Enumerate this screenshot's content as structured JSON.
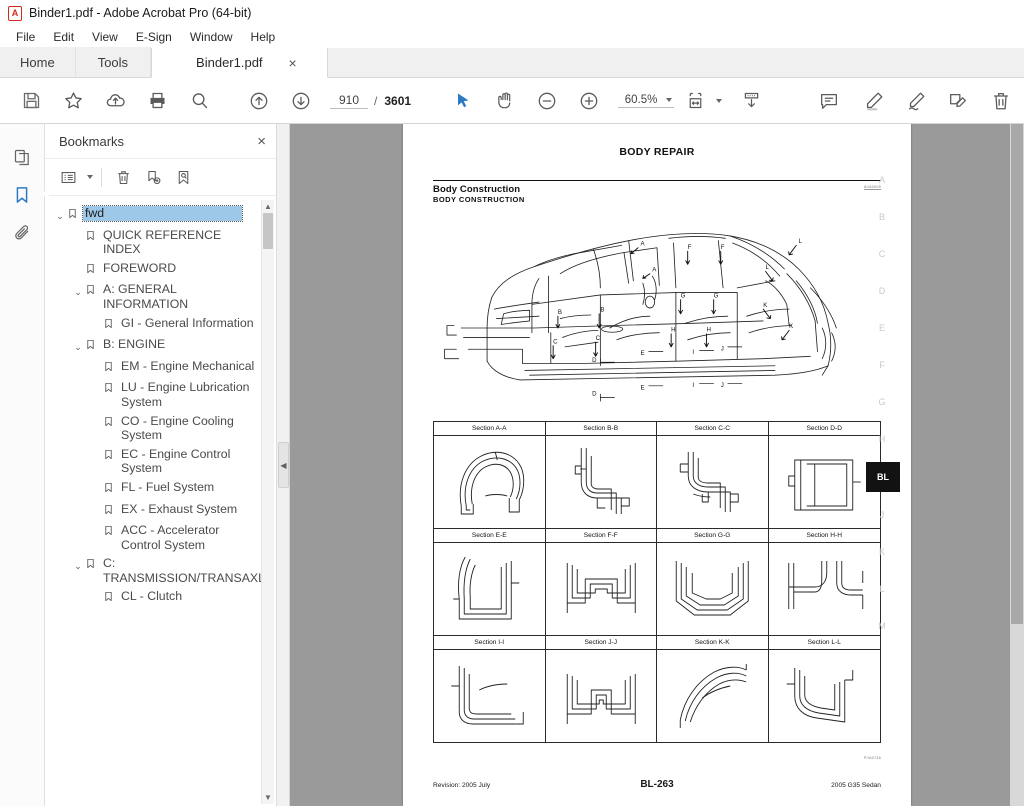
{
  "window": {
    "title": "Binder1.pdf - Adobe Acrobat Pro (64-bit)",
    "app_icon": "acrobat-logo-icon"
  },
  "menubar": {
    "items": [
      "File",
      "Edit",
      "View",
      "E-Sign",
      "Window",
      "Help"
    ]
  },
  "tabs": {
    "home": "Home",
    "tools": "Tools",
    "document": "Binder1.pdf",
    "close_glyph": "×"
  },
  "toolbar": {
    "icons": [
      "save-icon",
      "star-icon",
      "upload-cloud-icon",
      "print-icon",
      "search-icon",
      "previous-page-icon",
      "next-page-icon"
    ],
    "page_current": "910",
    "page_separator": "/",
    "page_total": "3601",
    "select_tool": "select-cursor-icon",
    "hand_tool": "hand-icon",
    "zoom_out": "zoom-out-icon",
    "zoom_in": "zoom-in-icon",
    "zoom_level": "60.5%",
    "fit_page": "fit-page-icon",
    "scroll_mode": "page-scroll-icon",
    "comment": "comment-icon",
    "highlight": "highlight-pen-icon",
    "draw": "freehand-draw-icon",
    "sign": "sign-icon",
    "delete": "trash-icon"
  },
  "rail": {
    "items": [
      {
        "name": "page-thumbnails-icon",
        "label": "Page Thumbnails",
        "active": false
      },
      {
        "name": "bookmarks-icon",
        "label": "Bookmarks",
        "active": true
      },
      {
        "name": "attachments-icon",
        "label": "Attachments",
        "active": false
      }
    ]
  },
  "bookmarks_panel": {
    "title": "Bookmarks",
    "close_glyph": "×",
    "tools": [
      "bookmark-options-icon",
      "delete-bookmark-icon",
      "new-bookmark-icon",
      "find-bookmark-icon"
    ],
    "scroll_up_glyph": "▲",
    "scroll_down_glyph": "▼",
    "items": [
      {
        "label": "fwd",
        "indent": 0,
        "twisty": "⌄",
        "selected": true
      },
      {
        "label": "QUICK REFERENCE INDEX",
        "indent": 1,
        "twisty": "",
        "selected": false
      },
      {
        "label": "FOREWORD",
        "indent": 1,
        "twisty": "",
        "selected": false
      },
      {
        "label": "A: GENERAL INFORMATION",
        "indent": 1,
        "twisty": "⌄",
        "selected": false
      },
      {
        "label": "GI - General Information",
        "indent": 2,
        "twisty": "",
        "selected": false
      },
      {
        "label": "B: ENGINE",
        "indent": 1,
        "twisty": "⌄",
        "selected": false
      },
      {
        "label": "EM - Engine Mechanical",
        "indent": 2,
        "twisty": "",
        "selected": false
      },
      {
        "label": "LU - Engine Lubrication System",
        "indent": 2,
        "twisty": "",
        "selected": false
      },
      {
        "label": "CO - Engine Cooling System",
        "indent": 2,
        "twisty": "",
        "selected": false
      },
      {
        "label": "EC - Engine Control System",
        "indent": 2,
        "twisty": "",
        "selected": false
      },
      {
        "label": "FL - Fuel System",
        "indent": 2,
        "twisty": "",
        "selected": false
      },
      {
        "label": "EX - Exhaust System",
        "indent": 2,
        "twisty": "",
        "selected": false
      },
      {
        "label": "ACC - Accelerator Control System",
        "indent": 2,
        "twisty": "",
        "selected": false
      },
      {
        "label": "C: TRANSMISSION/TRANSAXLE",
        "indent": 1,
        "twisty": "⌄",
        "selected": false
      },
      {
        "label": "CL - Clutch",
        "indent": 2,
        "twisty": "",
        "selected": false
      }
    ]
  },
  "collapse_handle": {
    "glyph": "◀"
  },
  "document": {
    "header_title": "BODY REPAIR",
    "section_title": "Body Construction",
    "section_subtitle": "BODY CONSTRUCTION",
    "illustration_code": "AIIA0005",
    "illustration_code_2": "PIIA0746",
    "diagram_callouts": [
      "A",
      "A",
      "B",
      "B",
      "C",
      "C",
      "D",
      "D",
      "E",
      "E",
      "F",
      "F",
      "G",
      "G",
      "H",
      "H",
      "I",
      "I",
      "J",
      "J",
      "K",
      "K",
      "L",
      "L"
    ],
    "section_grid": [
      [
        "Section A-A",
        "Section B-B",
        "Section C-C",
        "Section D-D"
      ],
      [
        "Section E-E",
        "Section F-F",
        "Section G-G",
        "Section H-H"
      ],
      [
        "Section I-I",
        "Section J-J",
        "Section K-K",
        "Section L-L"
      ]
    ],
    "footer": {
      "revision": "Revision: 2005 July",
      "page_label": "BL-263",
      "model": "2005 G35 Sedan"
    },
    "tab_index": [
      {
        "label": "A",
        "active": false
      },
      {
        "label": "B",
        "active": false
      },
      {
        "label": "C",
        "active": false
      },
      {
        "label": "D",
        "active": false
      },
      {
        "label": "E",
        "active": false
      },
      {
        "label": "F",
        "active": false
      },
      {
        "label": "G",
        "active": false
      },
      {
        "label": "H",
        "active": false
      },
      {
        "label": "BL",
        "active": true
      },
      {
        "label": "J",
        "active": false
      },
      {
        "label": "K",
        "active": false
      },
      {
        "label": "L",
        "active": false
      },
      {
        "label": "M",
        "active": false
      }
    ]
  },
  "colors": {
    "accent": "#2d7ac4",
    "selection": "#9ec8e8",
    "viewport_bg": "#9a9a9a",
    "brand_red": "#cf2b1d"
  }
}
